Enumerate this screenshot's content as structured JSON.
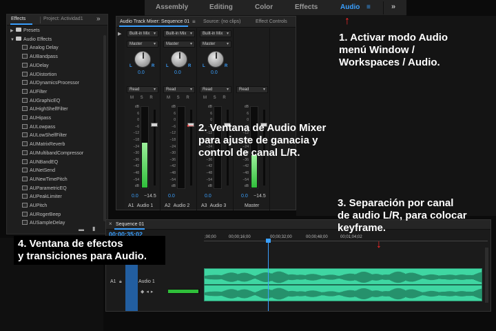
{
  "workspaces": {
    "tabs": [
      "Assembly",
      "Editing",
      "Color",
      "Effects",
      "Audio"
    ],
    "active": "Audio",
    "menu_glyph": "≡",
    "more_glyph": "»"
  },
  "effects_panel": {
    "tabs": [
      "Effects",
      "Project: Actividad1"
    ],
    "more_glyph": "»",
    "tree": [
      {
        "label": "Presets",
        "type": "folder",
        "expanded": false
      },
      {
        "label": "Audio Effects",
        "type": "folder",
        "expanded": true
      },
      {
        "label": "Analog Delay",
        "type": "effect"
      },
      {
        "label": "AUBandpass",
        "type": "effect"
      },
      {
        "label": "AUDelay",
        "type": "effect"
      },
      {
        "label": "AUDistortion",
        "type": "effect"
      },
      {
        "label": "AUDynamicsProcessor",
        "type": "effect"
      },
      {
        "label": "AUFilter",
        "type": "effect"
      },
      {
        "label": "AUGraphicEQ",
        "type": "effect"
      },
      {
        "label": "AUHighShelfFilter",
        "type": "effect"
      },
      {
        "label": "AUHipass",
        "type": "effect"
      },
      {
        "label": "AULowpass",
        "type": "effect"
      },
      {
        "label": "AULowShelfFilter",
        "type": "effect"
      },
      {
        "label": "AUMatrixReverb",
        "type": "effect"
      },
      {
        "label": "AUMultibandCompressor",
        "type": "effect"
      },
      {
        "label": "AUNBandEQ",
        "type": "effect"
      },
      {
        "label": "AUNetSend",
        "type": "effect"
      },
      {
        "label": "AUNewTimePitch",
        "type": "effect"
      },
      {
        "label": "AUParametricEQ",
        "type": "effect"
      },
      {
        "label": "AUPeakLimiter",
        "type": "effect"
      },
      {
        "label": "AUPitch",
        "type": "effect"
      },
      {
        "label": "AURogerBeep",
        "type": "effect"
      },
      {
        "label": "AUSampleDelay",
        "type": "effect"
      }
    ]
  },
  "mixer": {
    "tabs": [
      "Audio Track Mixer: Sequence 01",
      "Source: (no clips)",
      "Effect Controls"
    ],
    "tab_menu_glyph": "≡",
    "channels": [
      {
        "input": "Built-in Mix",
        "output": "Master",
        "pan": "0.0",
        "mode": "Read",
        "msr": "M S R",
        "volume": "0.0",
        "peak": "−14.5",
        "track": "A1",
        "name": "Audio 1",
        "level": 0.55
      },
      {
        "input": "Built-in Mix",
        "output": "Master",
        "pan": "0.0",
        "mode": "Read",
        "msr": "M S R",
        "volume": "0.0",
        "peak": "",
        "track": "A2",
        "name": "Audio 2",
        "level": 0.0
      },
      {
        "input": "Built-in Mix",
        "output": "Master",
        "pan": "0.0",
        "mode": "Read",
        "msr": "M S R",
        "volume": "0.0",
        "peak": "",
        "track": "A3",
        "name": "Audio 3",
        "level": 0.0
      },
      {
        "input": "",
        "output": "",
        "pan": "",
        "mode": "Read",
        "msr": "",
        "volume": "0.0",
        "peak": "−14.5",
        "track": "",
        "name": "Master",
        "level": 0.4
      }
    ],
    "scale": [
      "dB",
      "6",
      "0",
      "−6",
      "−12",
      "−18",
      "−24",
      "−30",
      "−36",
      "−42",
      "−48",
      "−54",
      "dB"
    ]
  },
  "timeline": {
    "tab": "Sequence 01",
    "timecode": "00:00:35:02",
    "ruler": [
      ";00;00",
      "00;00;16;00",
      "00;00;32;00",
      "00;00;48;00",
      "00;01;04;02"
    ],
    "tracks": [
      {
        "left_label": "A1",
        "name": "Audio 1"
      }
    ]
  },
  "annotations": [
    {
      "id": "note1",
      "text": "1. Activar modo Audio\nmenú Window /\nWorkspaces / Audio."
    },
    {
      "id": "note2",
      "text": "2. Ventana de Audio Mixer\npara ajuste de ganacia y\ncontrol de canal L/R."
    },
    {
      "id": "note3",
      "text": "3. Separación por canal\nde audio L/R, para colocar\nkeyframe."
    },
    {
      "id": "note4",
      "text": "4. Ventana de efectos\ny transiciones para Audio."
    }
  ],
  "colors": {
    "accent": "#3aa0ff",
    "meter_green": "#2fbf3a",
    "clip": "#3fd6a2",
    "arrow": "#ff2a2a"
  }
}
